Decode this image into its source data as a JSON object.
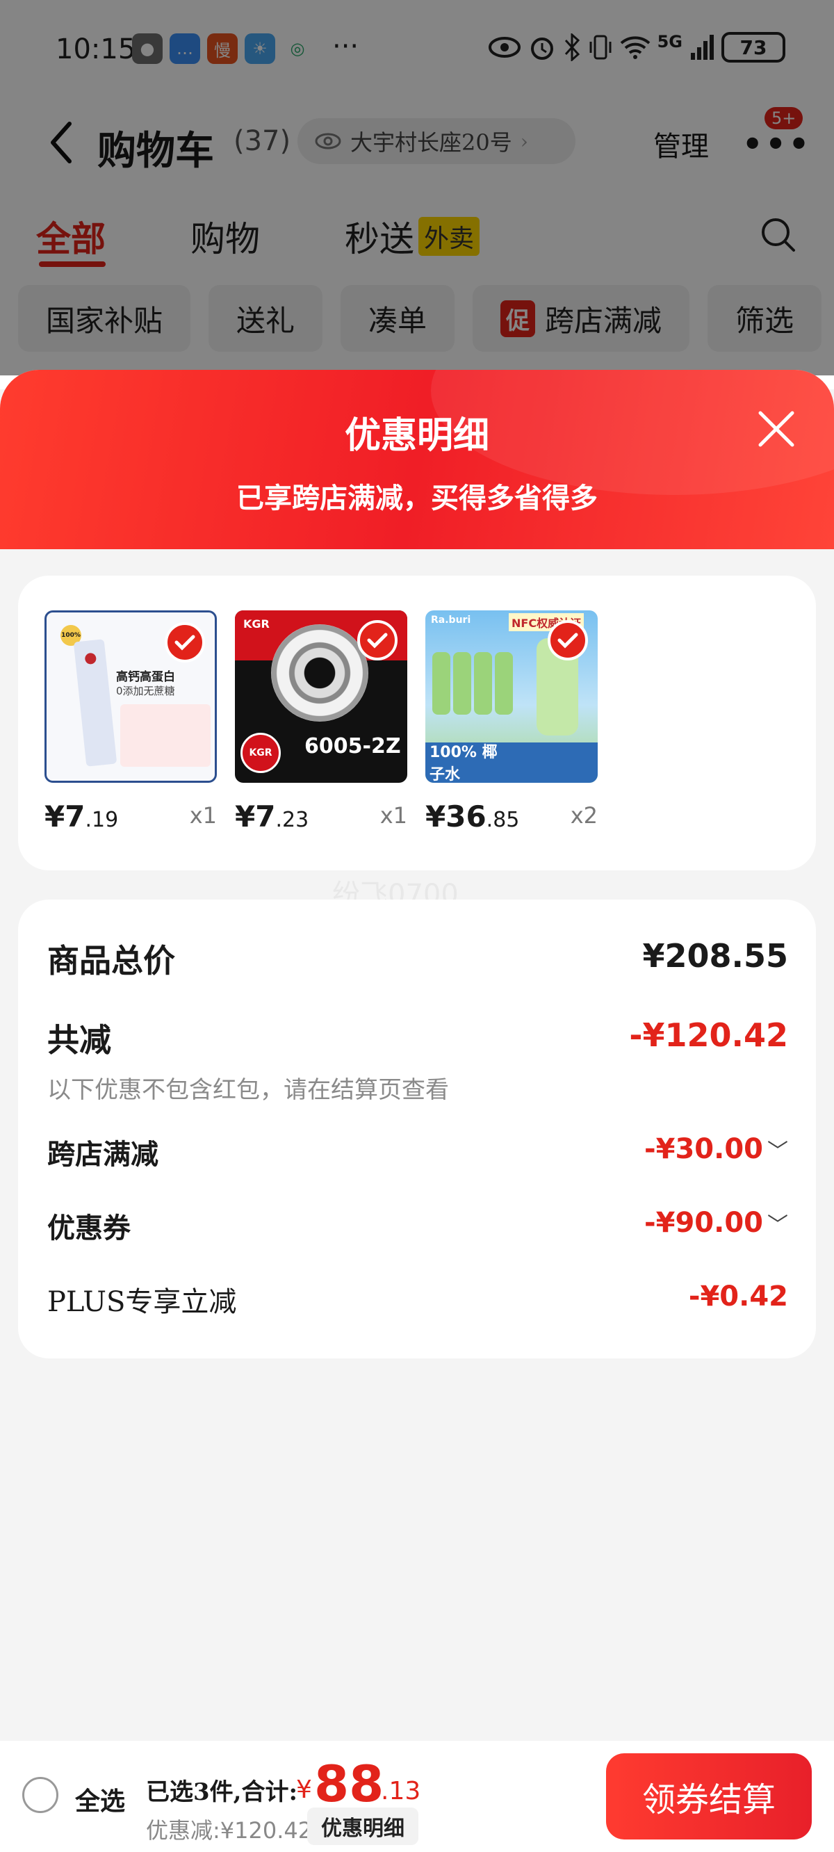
{
  "status_bar": {
    "time": "10:15",
    "app_icons": [
      {
        "name": "wechat-icon",
        "color": "#6e6e6e",
        "glyph": "●"
      },
      {
        "name": "messages-icon",
        "color": "#3a8ef6",
        "glyph": "…"
      },
      {
        "name": "app-slow-icon",
        "color": "#e8531f",
        "glyph": "慢"
      },
      {
        "name": "weather-icon",
        "color": "#4aa7f2",
        "glyph": "☀"
      },
      {
        "name": "mobile-carrier-icon",
        "color": "#ffffff",
        "glyph": "◎"
      }
    ],
    "more": "···",
    "network": "5G",
    "battery": "73"
  },
  "cart_header": {
    "title": "购物车",
    "count": "(37)",
    "address": "大宇村长座20号",
    "manage": "管理",
    "more": "•••",
    "badge": "5+"
  },
  "tabs": [
    {
      "label": "全部",
      "tag": ""
    },
    {
      "label": "购物",
      "tag": ""
    },
    {
      "label": "秒送",
      "tag": "外卖"
    }
  ],
  "chips": [
    {
      "label": "国家补贴",
      "promo": ""
    },
    {
      "label": "送礼",
      "promo": ""
    },
    {
      "label": "凑单",
      "promo": ""
    },
    {
      "label": "跨店满减",
      "promo": "促"
    },
    {
      "label": "筛选",
      "promo": ""
    }
  ],
  "sheet": {
    "title": "优惠明细",
    "subtitle": "已享跨店满减，买得多省得多"
  },
  "products": [
    {
      "price_int": "¥7",
      "price_dec": ".19",
      "qty": "x1",
      "img_text_1": "高钙高蛋白",
      "img_text_2": "0添加无蔗糖",
      "img_badge": "100%"
    },
    {
      "price_int": "¥7",
      "price_dec": ".23",
      "qty": "x1",
      "img_text_1": "KGR",
      "img_text_2": "6005-2Z",
      "img_badge": "KGR"
    },
    {
      "price_int": "¥36",
      "price_dec": ".85",
      "qty": "x2",
      "img_text_1": "NFC权威认证",
      "img_text_2": "100% 椰子水",
      "img_badge": "Ra.buri"
    }
  ],
  "watermark": "纷飞0700",
  "summary": {
    "total_label": "商品总价",
    "total_value": "¥208.55",
    "reduce_label": "共减",
    "reduce_value": "-¥120.42",
    "note": "以下优惠不包含红包，请在结算页查看",
    "items": [
      {
        "label": "跨店满减",
        "value": "-¥30.00",
        "expand": "﹀"
      },
      {
        "label": "优惠券",
        "value": "-¥90.00",
        "expand": "﹀"
      },
      {
        "label": "PLUS专享立减",
        "value": "-¥0.42",
        "expand": ""
      }
    ]
  },
  "bottom_bar": {
    "select_all": "全选",
    "selected": "已选3件,合计:",
    "currency": "¥",
    "total_int": "88",
    "total_dec": ".13",
    "discount": "优惠减:¥120.42",
    "detail": "优惠明细",
    "checkout": "领券结算"
  },
  "colors": {
    "accent": "#e2231a",
    "header_gradient_start": "#ff3c2e",
    "header_gradient_end": "#f01e26"
  }
}
